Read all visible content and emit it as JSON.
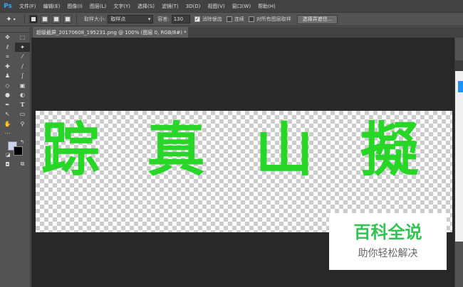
{
  "app": {
    "logo": "Ps"
  },
  "menu": [
    "文件(F)",
    "编辑(E)",
    "图像(I)",
    "图层(L)",
    "文字(Y)",
    "选择(S)",
    "滤镜(T)",
    "3D(D)",
    "视图(V)",
    "窗口(W)",
    "帮助(H)"
  ],
  "options": {
    "sample_size_label": "取样大小:",
    "sample_size_value": "取样点",
    "tolerance_label": "容差:",
    "tolerance_value": "130",
    "antialias_label": "消除锯齿",
    "antialias_checked": true,
    "contiguous_label": "连续",
    "contiguous_checked": false,
    "all_layers_label": "对所有图层取样",
    "all_layers_checked": false,
    "select_mask_button": "选择并遮住..."
  },
  "document": {
    "tab_title": "超级截屏_20170608_195231.png @ 100% (图层 0, RGB/8#) *",
    "close_glyph": "×"
  },
  "canvas": {
    "characters": [
      "踪",
      "真",
      "山",
      "擬"
    ],
    "text_color": "#27d627"
  },
  "colors": {
    "foreground": "#c9d3ec",
    "background": "#000000"
  },
  "watermark": {
    "title": "百科全说",
    "subtitle": "助你轻松解决"
  }
}
